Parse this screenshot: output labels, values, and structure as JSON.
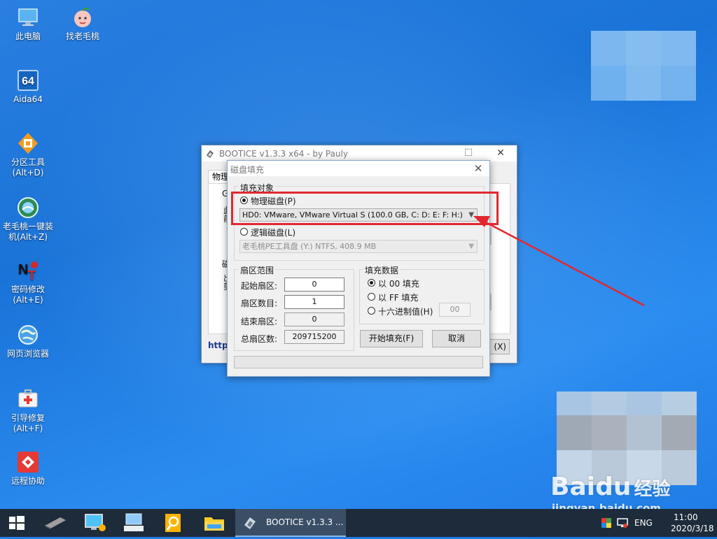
{
  "desktop": {
    "icons": [
      {
        "label": "此电脑",
        "icon": "computer-icon"
      },
      {
        "label": "找老毛桃",
        "icon": "peach-icon"
      },
      {
        "label": "Aida64",
        "icon": "aida64-icon",
        "glyph": "64"
      },
      {
        "label_line1": "分区工具",
        "label_line2": "(Alt+D)",
        "icon": "partition-tool-icon"
      },
      {
        "label_line1": "老毛桃一键装",
        "label_line2": "机(Alt+Z)",
        "icon": "one-key-install-icon"
      },
      {
        "label_line1": "密码修改",
        "label_line2": "(Alt+E)",
        "icon": "password-tool-icon"
      },
      {
        "label": "网页浏览器",
        "icon": "browser-icon"
      },
      {
        "label_line1": "引导修复",
        "label_line2": "(Alt+F)",
        "icon": "boot-repair-icon"
      },
      {
        "label": "远程协助",
        "icon": "remote-assist-icon"
      }
    ]
  },
  "bootice": {
    "title": "BOOTICE v1.3.3 x64 - by Pauly",
    "tab_fragment": "物理",
    "group_fragment": "G",
    "left_chars_1": "此",
    "left_chars_2": "前",
    "group2_fragment": "磁",
    "left_chars_3": "出",
    "left_chars_4": "剪",
    "link_fragment": "http",
    "button_fragment": "(X)"
  },
  "dialog": {
    "title": "磁盘填充",
    "target_group": "填充对象",
    "physical_disk_label": "物理磁盘(P)",
    "physical_disk_value": "HD0: VMware, VMware Virtual S (100.0 GB, C: D: E: F: H:)",
    "logical_disk_label": "逻辑磁盘(L)",
    "logical_disk_value": "老毛桃PE工具盘 (Y:)  NTFS, 408.9 MB",
    "sector_group": "扇区范围",
    "start_sector_label": "起始扇区:",
    "start_sector_value": "0",
    "sector_count_label": "扇区数目:",
    "sector_count_value": "1",
    "end_sector_label": "结束扇区:",
    "end_sector_value": "0",
    "total_sectors_label": "总扇区数:",
    "total_sectors_value": "209715200",
    "fill_group": "填充数据",
    "fill_00_label": "以 00 填充",
    "fill_ff_label": "以 FF 填充",
    "fill_hex_label": "十六进制值(H)",
    "fill_hex_value": "00",
    "start_button": "开始填充(F)",
    "cancel_button": "取消",
    "selected_target": "physical",
    "selected_fill": "00"
  },
  "taskbar": {
    "active_task": "BOOTICE v1.3.3 ...",
    "language": "ENG",
    "time": "11:00",
    "date": "2020/3/18"
  },
  "watermark": {
    "brand": "Baidu",
    "brand_cn": "经验",
    "site": "jingyan.baidu.com"
  },
  "colors": {
    "highlight": "#e2282f",
    "desktop": "#1f7be6",
    "taskbar": "#1d2b3a"
  }
}
